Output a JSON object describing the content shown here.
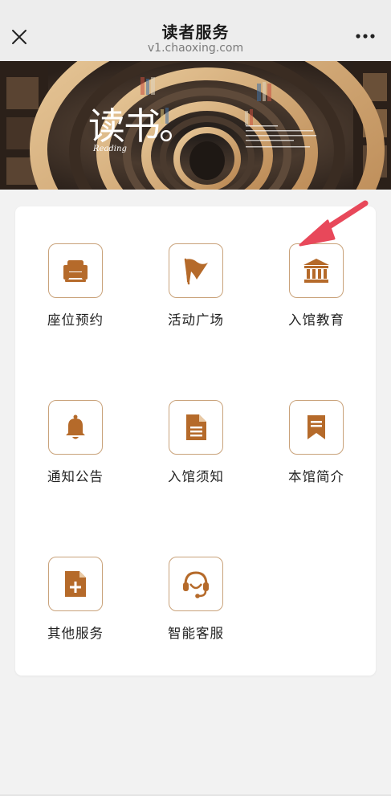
{
  "header": {
    "title": "读者服务",
    "subtitle": "v1.chaoxing.com"
  },
  "banner": {
    "logo_text": "读书。",
    "logo_sub": "Reading"
  },
  "services": [
    {
      "label": "座位预约",
      "icon": "armchair-icon"
    },
    {
      "label": "活动广场",
      "icon": "flag-icon"
    },
    {
      "label": "入馆教育",
      "icon": "bank-building-icon"
    },
    {
      "label": "通知公告",
      "icon": "bell-icon"
    },
    {
      "label": "入馆须知",
      "icon": "document-icon"
    },
    {
      "label": "本馆简介",
      "icon": "bookmark-icon"
    },
    {
      "label": "其他服务",
      "icon": "file-plus-icon"
    },
    {
      "label": "智能客服",
      "icon": "headset-icon"
    }
  ],
  "colors": {
    "accent": "#b56a2a",
    "icon_border": "#c9a27a",
    "arrow": "#e8485a",
    "background": "#f2f2f2"
  }
}
